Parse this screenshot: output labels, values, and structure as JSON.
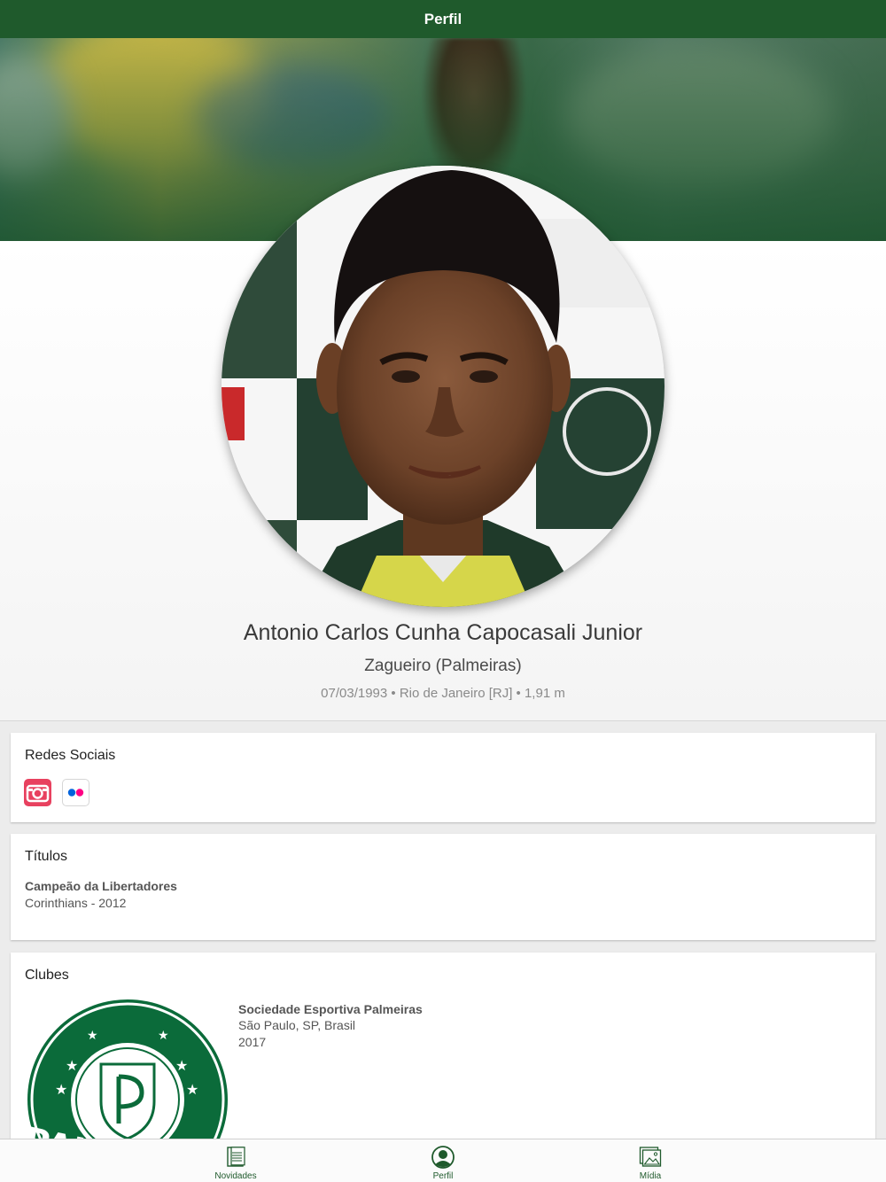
{
  "navbar": {
    "title": "Perfil"
  },
  "player": {
    "name": "Antonio Carlos Cunha Capocasali Junior",
    "position": "Zagueiro (Palmeiras)",
    "meta": "07/03/1993 • Rio de Janeiro [RJ] • 1,91 m"
  },
  "social": {
    "title": "Redes Sociais",
    "icons": [
      "instagram-icon",
      "flickr-icon"
    ]
  },
  "titles": {
    "title": "Títulos",
    "items": [
      {
        "name": "Campeão da Libertadores",
        "detail": "Corinthians - 2012"
      }
    ]
  },
  "clubs": {
    "title": "Clubes",
    "items": [
      {
        "name": "Sociedade Esportiva Palmeiras",
        "location": "São Paulo, SP, Brasil",
        "year": "2017",
        "logo_text": "PALMEIRAS"
      }
    ]
  },
  "tabbar": {
    "tabs": [
      {
        "label": "Novidades",
        "icon": "news-icon"
      },
      {
        "label": "Perfil",
        "icon": "profile-icon",
        "active": true
      },
      {
        "label": "Mídia",
        "icon": "media-icon"
      }
    ]
  },
  "colors": {
    "primary": "#1f5a2c",
    "instagram": "#e8415f",
    "flickr_blue": "#0063dc",
    "flickr_pink": "#ff0084"
  }
}
